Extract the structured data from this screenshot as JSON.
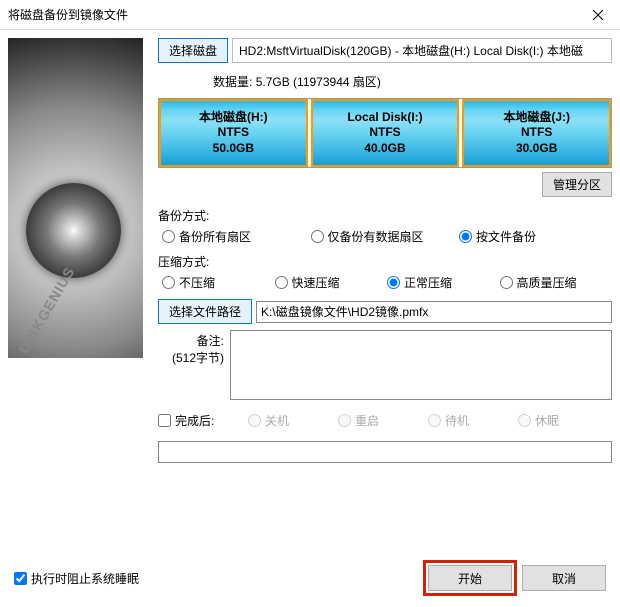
{
  "window": {
    "title": "将磁盘备份到镜像文件"
  },
  "toolbar": {
    "select_disk_label": "选择磁盘",
    "disk_desc": "HD2:MsftVirtualDisk(120GB) - 本地磁盘(H:) Local Disk(I:) 本地磁",
    "data_amount_label": "数据量:",
    "data_amount_value": "5.7GB (11973944 扇区)"
  },
  "partitions": [
    {
      "name": "本地磁盘(H:)",
      "fs": "NTFS",
      "size": "50.0GB"
    },
    {
      "name": "Local Disk(I:)",
      "fs": "NTFS",
      "size": "40.0GB"
    },
    {
      "name": "本地磁盘(J:)",
      "fs": "NTFS",
      "size": "30.0GB"
    }
  ],
  "manage_partitions_label": "管理分区",
  "backup_mode": {
    "label": "备份方式:",
    "options": [
      "备份所有扇区",
      "仅备份有数据扇区",
      "按文件备份"
    ],
    "selected": 2
  },
  "compress_mode": {
    "label": "压缩方式:",
    "options": [
      "不压缩",
      "快速压缩",
      "正常压缩",
      "高质量压缩"
    ],
    "selected": 2
  },
  "path": {
    "button_label": "选择文件路径",
    "value": "K:\\磁盘镜像文件\\HD2镜像.pmfx"
  },
  "remark": {
    "label": "备注:",
    "sublabel": "(512字节)",
    "value": ""
  },
  "after_done": {
    "checkbox_label": "完成后:",
    "options": [
      "关机",
      "重启",
      "待机",
      "休眠"
    ],
    "enabled": false
  },
  "bottom": {
    "prevent_sleep_label": "执行时阻止系统睡眠",
    "prevent_sleep_checked": true,
    "start_label": "开始",
    "cancel_label": "取消"
  }
}
